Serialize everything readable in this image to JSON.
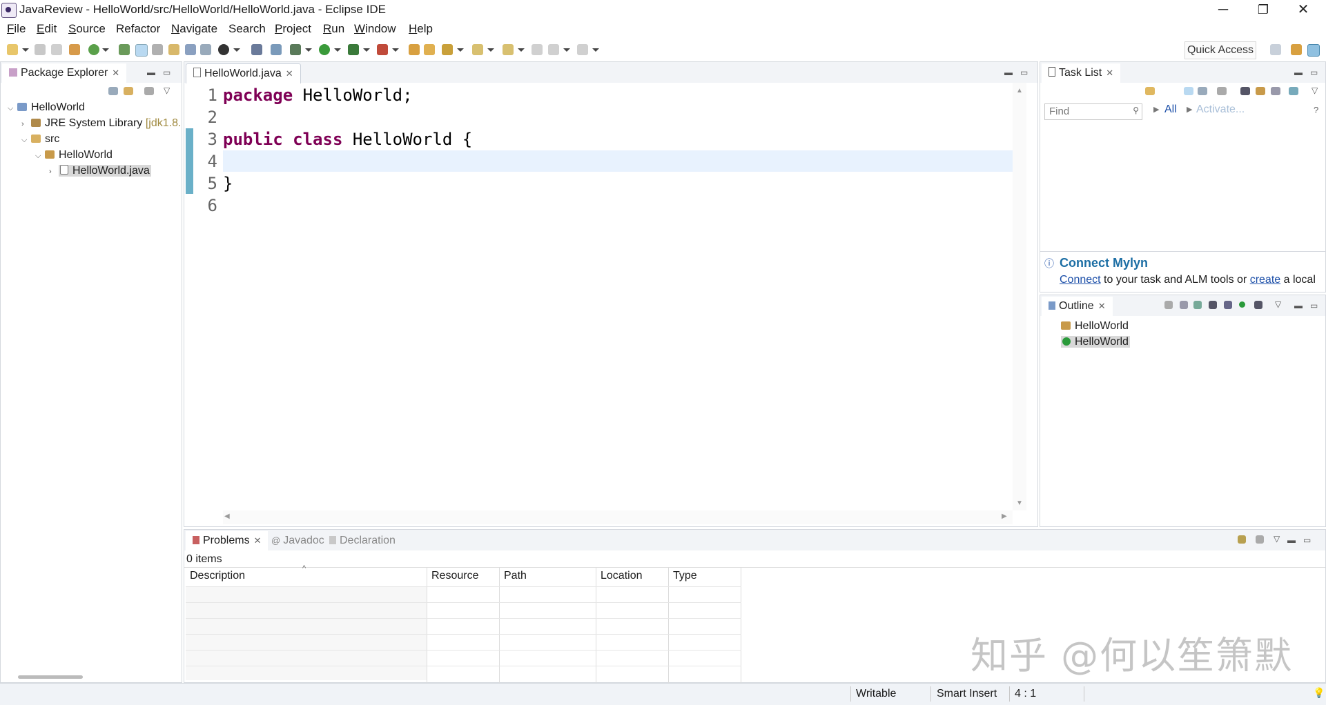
{
  "window": {
    "title": "JavaReview - HelloWorld/src/HelloWorld/HelloWorld.java - Eclipse IDE",
    "minimize": "─",
    "restore": "❐",
    "close": "✕"
  },
  "menu": [
    {
      "label": "File",
      "u": "F",
      "rest": "ile"
    },
    {
      "label": "Edit",
      "u": "E",
      "rest": "dit"
    },
    {
      "label": "Source",
      "u": "S",
      "rest": "ource"
    },
    {
      "label": "Refactor",
      "u": "",
      "rest": "Refactor"
    },
    {
      "label": "Navigate",
      "u": "N",
      "rest": "avigate"
    },
    {
      "label": "Search",
      "u": "",
      "rest": "Search"
    },
    {
      "label": "Project",
      "u": "P",
      "rest": "roject"
    },
    {
      "label": "Run",
      "u": "R",
      "rest": "un"
    },
    {
      "label": "Window",
      "u": "W",
      "rest": "indow"
    },
    {
      "label": "Help",
      "u": "H",
      "rest": "elp"
    }
  ],
  "toolbar": {
    "quick_access": "Quick Access"
  },
  "package_explorer": {
    "tab_label": "Package Explorer",
    "tree": {
      "project": "HelloWorld",
      "jre_label": "JRE System Library",
      "jre_version": "[jdk1.8.",
      "src": "src",
      "package": "HelloWorld",
      "file": "HelloWorld.java"
    }
  },
  "editor": {
    "tab_label": "HelloWorld.java",
    "lines": [
      {
        "no": "1",
        "kw": "package",
        "text": " HelloWorld;"
      },
      {
        "no": "2",
        "kw": "",
        "text": ""
      },
      {
        "no": "3",
        "kw": "public class",
        "text": " HelloWorld {"
      },
      {
        "no": "4",
        "kw": "",
        "text": ""
      },
      {
        "no": "5",
        "kw": "",
        "text": "}"
      },
      {
        "no": "6",
        "kw": "",
        "text": ""
      }
    ]
  },
  "task_list": {
    "tab_label": "Task List",
    "find_placeholder": "Find",
    "all_label": "All",
    "activate_label": "Activate...",
    "mylyn_title": "Connect Mylyn",
    "mylyn_connect": "Connect",
    "mylyn_middle": " to your task and ALM tools or ",
    "mylyn_create": "create",
    "mylyn_end": " a local"
  },
  "outline": {
    "tab_label": "Outline",
    "items": [
      "HelloWorld",
      "HelloWorld"
    ]
  },
  "problems": {
    "tab_label": "Problems",
    "tab_javadoc": "Javadoc",
    "tab_declaration": "Declaration",
    "count": "0 items",
    "columns": [
      "Description",
      "Resource",
      "Path",
      "Location",
      "Type"
    ]
  },
  "status": {
    "writable": "Writable",
    "insert_mode": "Smart Insert",
    "position": "4 : 1"
  },
  "watermark": "知乎 @何以笙箫默",
  "colors": {
    "keyword": "#7f0055",
    "link": "#1c4fa8",
    "current_line": "#e8f2fe"
  }
}
